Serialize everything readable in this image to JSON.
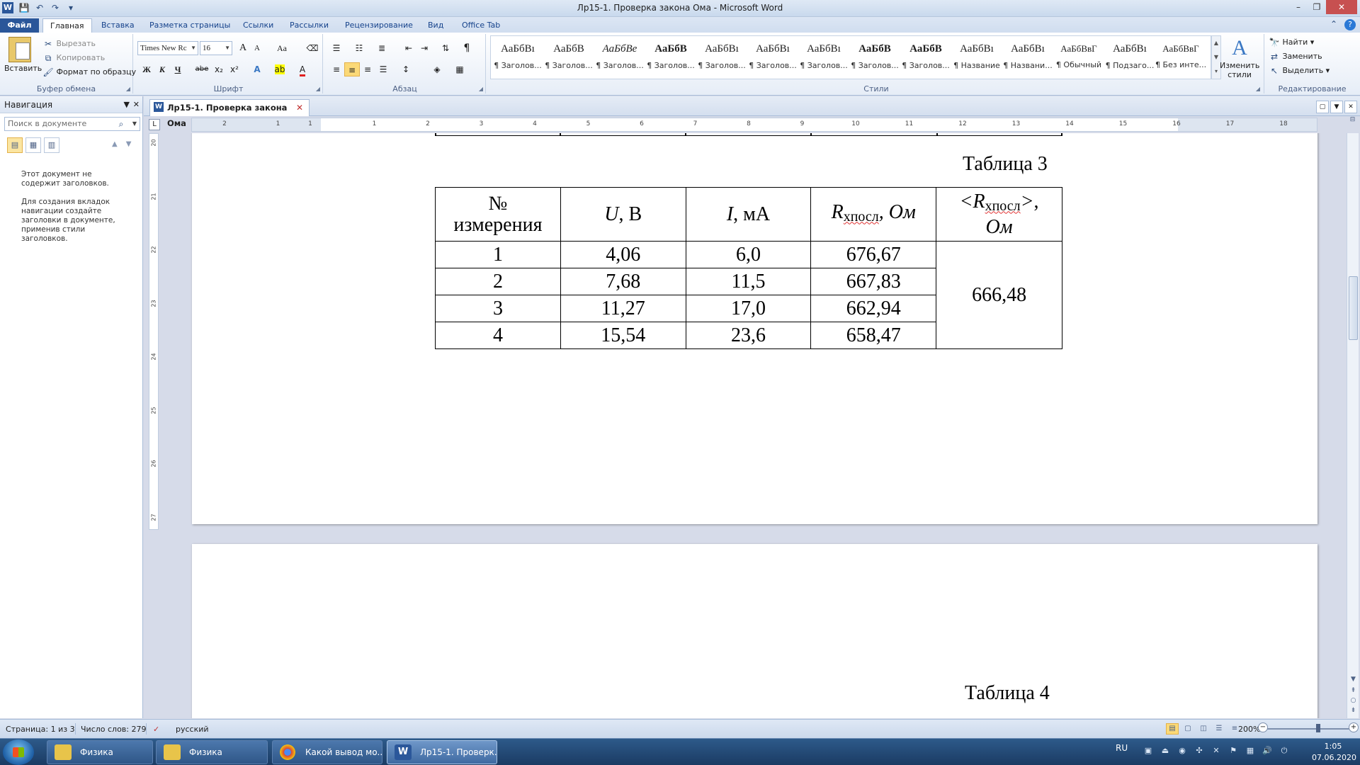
{
  "window": {
    "title": "Лр15-1. Проверка закона Ома  -  Microsoft Word"
  },
  "ribbon_tabs": {
    "file": "Файл",
    "home": "Главная",
    "insert": "Вставка",
    "page_layout": "Разметка страницы",
    "references": "Ссылки",
    "mailings": "Рассылки",
    "review": "Рецензирование",
    "view": "Вид",
    "office_tab": "Office Tab"
  },
  "clipboard": {
    "paste": "Вставить",
    "cut": "Вырезать",
    "copy": "Копировать",
    "format_painter": "Формат по образцу",
    "label": "Буфер обмена"
  },
  "font": {
    "name": "Times New Rc",
    "size": "16",
    "label": "Шрифт",
    "bold": "Ж",
    "italic": "К",
    "underline": "Ч",
    "strike": "abe",
    "subscript": "x₂",
    "superscript": "x²",
    "grow": "A",
    "shrink": "A",
    "case": "Aa"
  },
  "paragraph": {
    "label": "Абзац",
    "pilcrow": "¶"
  },
  "styles": {
    "label": "Стили",
    "items": [
      {
        "sample": "АаБбВı",
        "name": "¶ Заголов..."
      },
      {
        "sample": "АаБбВ",
        "name": "¶ Заголов..."
      },
      {
        "sample": "АаБбВе",
        "name": "¶ Заголов..."
      },
      {
        "sample": "АаБбВ",
        "name": "¶ Заголов..."
      },
      {
        "sample": "АаБбВı",
        "name": "¶ Заголов..."
      },
      {
        "sample": "АаБбВı",
        "name": "¶ Заголов..."
      },
      {
        "sample": "АаБбВı",
        "name": "¶ Заголов..."
      },
      {
        "sample": "АаБбВ",
        "name": "¶ Заголов..."
      },
      {
        "sample": "АаБбВ",
        "name": "¶ Заголов..."
      },
      {
        "sample": "АаБбВı",
        "name": "¶ Название"
      },
      {
        "sample": "АаБбВı",
        "name": "¶ Названи..."
      },
      {
        "sample": "АаБбВвГ",
        "name": "¶ Обычный"
      },
      {
        "sample": "АаБбВı",
        "name": "¶ Подзаго..."
      },
      {
        "sample": "АаБбВвГ",
        "name": "¶ Без инте..."
      }
    ],
    "change_styles": "Изменить стили"
  },
  "editing": {
    "label": "Редактирование",
    "find": "Найти",
    "replace": "Заменить",
    "select": "Выделить"
  },
  "navigation": {
    "title": "Навигация",
    "search_placeholder": "Поиск в документе",
    "message_1": "Этот документ не содержит заголовков.",
    "message_2": "Для создания вкладок навигации создайте заголовки в документе, применив стили заголовков."
  },
  "doc_tab": {
    "label": "Лр15-1. Проверка закона Ома"
  },
  "ruler": {
    "h_numbers": [
      "2",
      "1",
      "1",
      "1",
      "2",
      "3",
      "4",
      "5",
      "6",
      "7",
      "8",
      "9",
      "10",
      "11",
      "12",
      "13",
      "14",
      "15",
      "16",
      "17",
      "18"
    ],
    "v_numbers": [
      "20",
      "21",
      "22",
      "23",
      "24",
      "25",
      "26",
      "27"
    ]
  },
  "document": {
    "table3_caption": "Таблица 3",
    "table4_caption": "Таблица 4",
    "table3": {
      "headers": {
        "col1_line1": "№",
        "col1_line2": "измерения",
        "col2_var": "U",
        "col2_unit": ", В",
        "col3_var": "I",
        "col3_unit": ", мА",
        "col4_var": "R",
        "col4_sub": "хпосл",
        "col4_unit": ", Ом",
        "col5_open": "<R",
        "col5_sub": "хпосл",
        "col5_close": ">",
        "col5_unit": "Ом"
      },
      "rows": [
        {
          "n": "1",
          "u": "4,06",
          "i": "6,0",
          "r": "676,67"
        },
        {
          "n": "2",
          "u": "7,68",
          "i": "11,5",
          "r": "667,83"
        },
        {
          "n": "3",
          "u": "11,27",
          "i": "17,0",
          "r": "662,94"
        },
        {
          "n": "4",
          "u": "15,54",
          "i": "23,6",
          "r": "658,47"
        }
      ],
      "mean_r": "666,48"
    }
  },
  "statusbar": {
    "page": "Страница: 1 из 3",
    "words": "Число слов: 279",
    "language": "русский",
    "zoom": "200%"
  },
  "taskbar": {
    "items": [
      {
        "label": "Физика",
        "icon_color": "#e8c44a"
      },
      {
        "label": "Физика",
        "icon_color": "#e8c44a"
      },
      {
        "label": "Какой вывод мо...",
        "icon_color": "#db4437"
      },
      {
        "label": "Лр15-1. Проверк...",
        "icon_color": "#2b579a"
      }
    ],
    "lang": "RU",
    "time": "1:05",
    "date": "07.06.2020"
  }
}
